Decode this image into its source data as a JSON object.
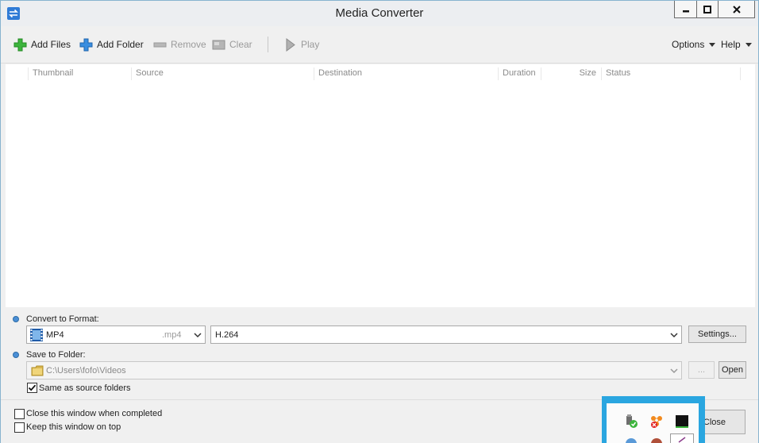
{
  "window": {
    "title": "Media Converter"
  },
  "toolbar": {
    "add_files": "Add Files",
    "add_folder": "Add Folder",
    "remove": "Remove",
    "clear": "Clear",
    "play": "Play",
    "options": "Options",
    "help": "Help"
  },
  "list": {
    "columns": [
      "Thumbnail",
      "Source",
      "Destination",
      "Duration",
      "Size",
      "Status"
    ]
  },
  "convert": {
    "label": "Convert to Format:",
    "format": "MP4",
    "extension": ".mp4",
    "codec": "H.264",
    "settings_label": "Settings..."
  },
  "save": {
    "label": "Save to Folder:",
    "folder_path": "C:\\Users\\fofo\\Videos",
    "browse_label": "...",
    "open_label": "Open",
    "same_as_source_label": "Same as source folders",
    "same_as_source_checked": true
  },
  "footer": {
    "close_when_completed_label": "Close this window when completed",
    "keep_on_top_label": "Keep this window on top",
    "close_button_label": "Close"
  },
  "colors": {
    "accent": "#2f7bd6",
    "tray_border": "#2aa6e0",
    "add_green": "#3cb43c",
    "add_blue": "#3a8ee0"
  }
}
